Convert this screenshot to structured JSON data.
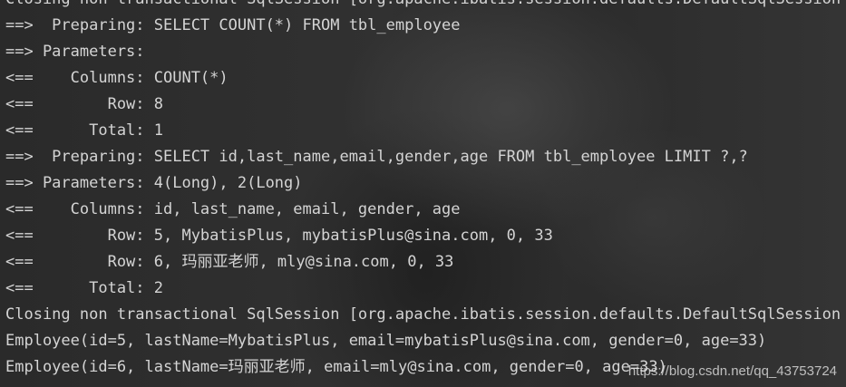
{
  "console": {
    "lines": [
      "Closing non transactional SqlSession [org.apache.ibatis.session.defaults.DefaultSqlSession",
      "==>  Preparing: SELECT COUNT(*) FROM tbl_employee",
      "==> Parameters: ",
      "<==    Columns: COUNT(*)",
      "<==        Row: 8",
      "<==      Total: 1",
      "==>  Preparing: SELECT id,last_name,email,gender,age FROM tbl_employee LIMIT ?,?",
      "==> Parameters: 4(Long), 2(Long)",
      "<==    Columns: id, last_name, email, gender, age",
      "<==        Row: 5, MybatisPlus, mybatisPlus@sina.com, 0, 33",
      "<==        Row: 6, 玛丽亚老师, mly@sina.com, 0, 33",
      "<==      Total: 2",
      "Closing non transactional SqlSession [org.apache.ibatis.session.defaults.DefaultSqlSession",
      "Employee(id=5, lastName=MybatisPlus, email=mybatisPlus@sina.com, gender=0, age=33)",
      "Employee(id=6, lastName=玛丽亚老师, email=mly@sina.com, gender=0, age=33)"
    ]
  },
  "watermark": "https://blog.csdn.net/qq_43753724",
  "colors": {
    "text": "#d4d4d4",
    "background": "#2b2b2b"
  }
}
